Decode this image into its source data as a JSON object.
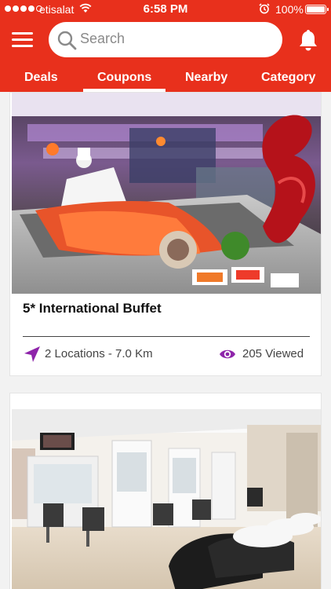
{
  "status_bar": {
    "carrier": "etisalat",
    "time": "6:58 PM",
    "battery": "100%"
  },
  "header": {
    "search_placeholder": "Search"
  },
  "tabs": [
    {
      "label": "Deals",
      "active": false
    },
    {
      "label": "Coupons",
      "active": true
    },
    {
      "label": "Nearby",
      "active": false
    },
    {
      "label": "Category",
      "active": false
    }
  ],
  "cards": [
    {
      "title": "5* International Buffet",
      "locations": "2 Locations - 7.0 Km",
      "views": "205 Viewed",
      "image": "buffet-photo"
    },
    {
      "title": "",
      "image": "salon-photo"
    }
  ],
  "colors": {
    "brand_red": "#e8301c",
    "accent_purple": "#8e24aa"
  },
  "icons": [
    "menu-icon",
    "search-icon",
    "bell-icon",
    "location-arrow-icon",
    "eye-icon"
  ]
}
